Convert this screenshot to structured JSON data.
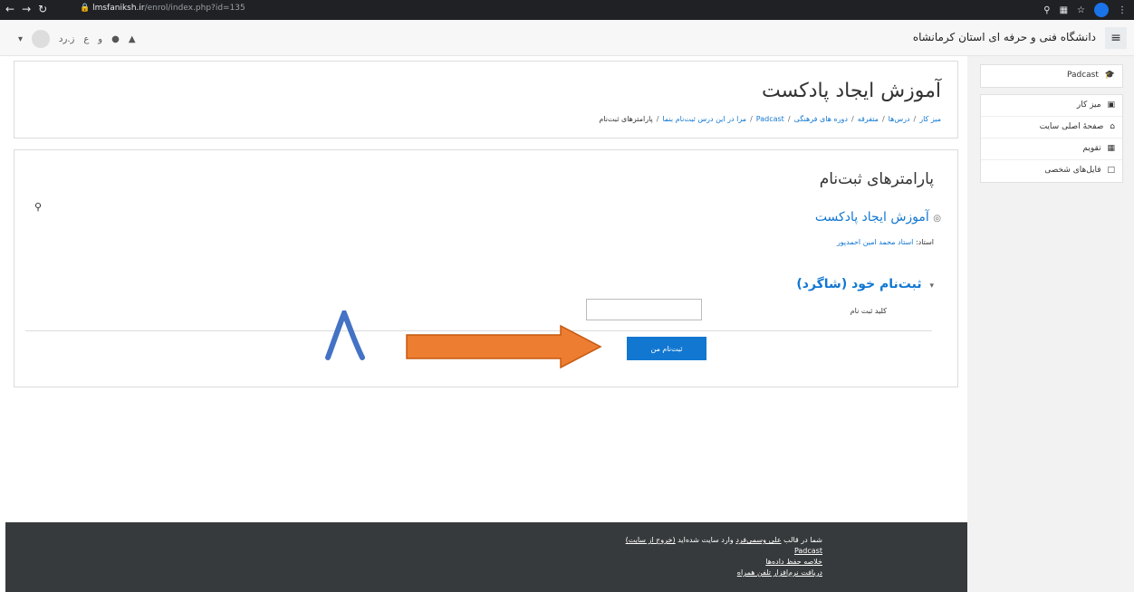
{
  "browser": {
    "url_host": "lmsfaniksh.ir",
    "url_path": "/enrol/index.php?id=135",
    "nav_icons": [
      "back-icon",
      "forward-icon",
      "reload-icon"
    ]
  },
  "navbar": {
    "site_name": "دانشگاه فنی و حرفه ای استان کرمانشاه",
    "toggle_icon": "≡",
    "user_initials": "ز.رد",
    "lang_text": "ع",
    "lang_text2": "و"
  },
  "sidebar": {
    "course_item": "Padcast",
    "items": [
      {
        "label": "میز کار",
        "icon": "dashboard-icon"
      },
      {
        "label": "صفحهٔ اصلی سایت",
        "icon": "home-icon"
      },
      {
        "label": "تقویم",
        "icon": "calendar-icon"
      },
      {
        "label": "فایل‌های شخصی",
        "icon": "file-icon"
      }
    ]
  },
  "header": {
    "title": "آموزش ایجاد پادکست",
    "breadcrumb": [
      "میز کار",
      "درس‌ها",
      "متفرقه",
      "دوره های فرهنگی",
      "Padcast",
      "مرا در این درس ثبت‌نام بنما"
    ],
    "breadcrumb_current": "پارامترهای ثبت‌نام"
  },
  "main": {
    "section_title": "پارامترهای ثبت‌نام",
    "course_name": "آموزش ایجاد پادکست",
    "teacher_label": "استاد:",
    "teacher_name": "استاد محمد امین احمدپور",
    "enrol_heading": "ثبت‌نام خود (شاگرد)",
    "key_label": "کلید ثبت نام",
    "key_value": "",
    "enrol_button": "ثبت‌نام من",
    "annotation_digit": "۸"
  },
  "footer": {
    "logged_in_prefix": "شما در قالب",
    "user_name": "علی وسمی‌فرد",
    "logged_in_suffix": "وارد سایت شده‌اید",
    "logout": "(خروج از سایت)",
    "course_link": "Padcast",
    "data_retention": "خلاصه حفظ داده‌ها",
    "mobile_app": "دریافت نرم‌افزار تلفن همراه"
  },
  "colors": {
    "accent": "#1177d1",
    "arrow": "#ed7d31",
    "annotation": "#4472c4",
    "footer_bg": "#373a3c"
  }
}
